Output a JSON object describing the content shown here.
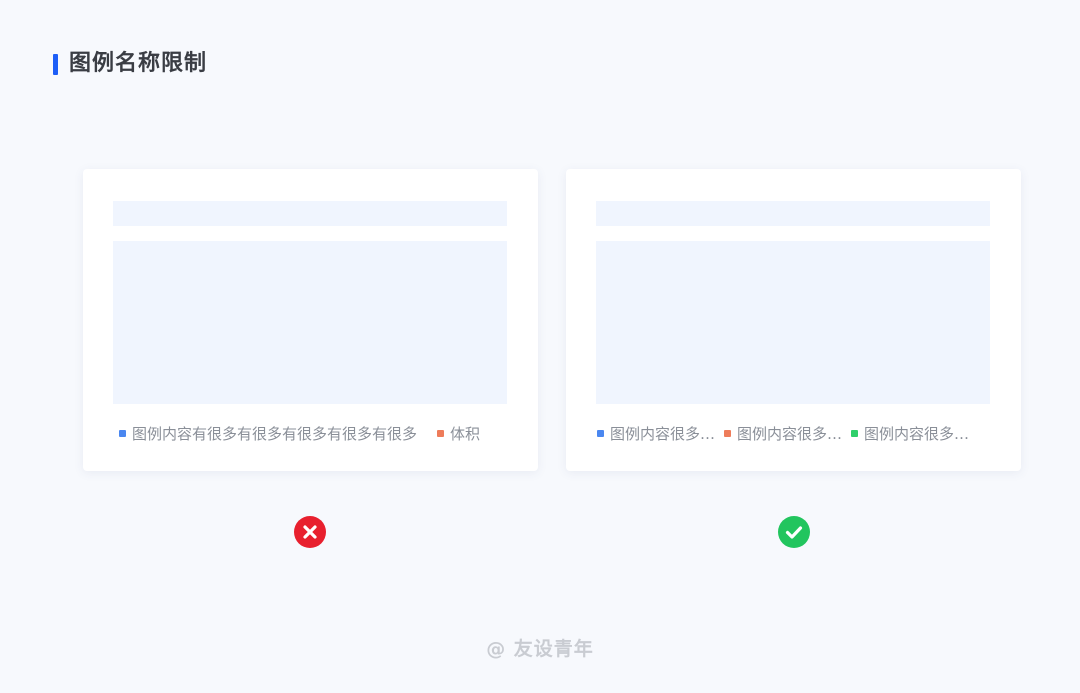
{
  "page": {
    "title": "图例名称限制",
    "accent_color": "#1d5ef7",
    "footer": "@ 友设青年"
  },
  "examples": [
    {
      "verdict": "incorrect",
      "verdict_icon": "cross-circle-icon",
      "verdict_color": "#e8202e",
      "legend": [
        {
          "label": "图例内容有很多有很多有很多有很多有很多",
          "color": "#4a87f0"
        },
        {
          "label": "体积",
          "color": "#ee7c5a"
        }
      ]
    },
    {
      "verdict": "correct",
      "verdict_icon": "check-circle-icon",
      "verdict_color": "#22c55e",
      "legend": [
        {
          "label": "图例内容很多…",
          "color": "#4a87f0"
        },
        {
          "label": "图例内容很多…",
          "color": "#ee7c5a"
        },
        {
          "label": "图例内容很多…",
          "color": "#2fcf6a"
        }
      ]
    }
  ]
}
